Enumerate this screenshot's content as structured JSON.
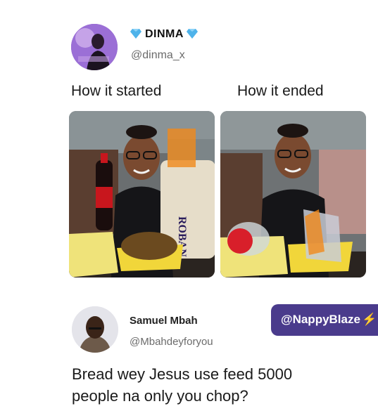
{
  "post": {
    "author_name": "DINMA",
    "author_handle": "@dinma_x",
    "caption_left": "How it started",
    "caption_right": "How it ended",
    "verified_icon": "blue-diamond-icon"
  },
  "reply": {
    "author_name": "Samuel Mbah",
    "author_handle": "@Mbahdeyforyou",
    "text": "Bread wey Jesus use feed 5000 people na only you chop?"
  },
  "watermark": {
    "label": "@NappyBlaze",
    "icon": "lightning-bolt-icon"
  },
  "photo_left": {
    "bread_label": "ROBAN"
  },
  "colors": {
    "watermark_bg": "#4a3b8c",
    "diamond": "#4fb3ea",
    "bolt": "#f5c518"
  }
}
